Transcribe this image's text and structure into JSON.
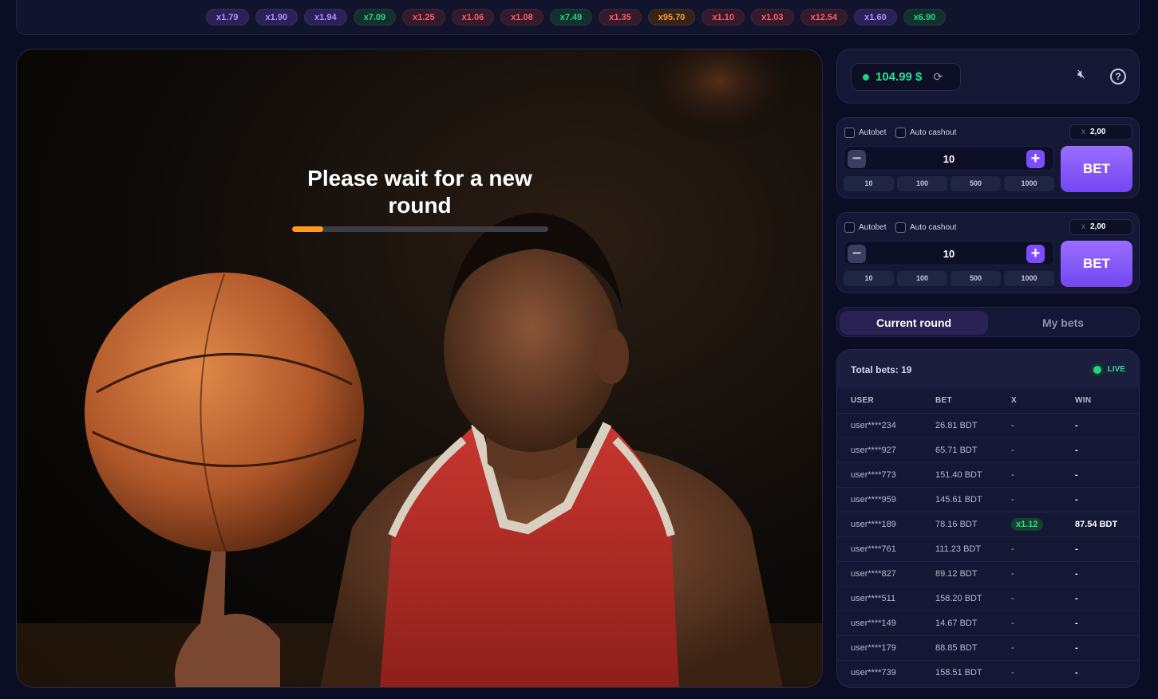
{
  "history": {
    "multipliers": [
      {
        "label": "x1.79",
        "tone": "purple"
      },
      {
        "label": "x1.90",
        "tone": "purple"
      },
      {
        "label": "x1.94",
        "tone": "purple"
      },
      {
        "label": "x7.09",
        "tone": "green"
      },
      {
        "label": "x1.25",
        "tone": "red"
      },
      {
        "label": "x1.06",
        "tone": "red"
      },
      {
        "label": "x1.08",
        "tone": "red"
      },
      {
        "label": "x7.49",
        "tone": "green"
      },
      {
        "label": "x1.35",
        "tone": "red"
      },
      {
        "label": "x95.70",
        "tone": "gold"
      },
      {
        "label": "x1.10",
        "tone": "red"
      },
      {
        "label": "x1.03",
        "tone": "red"
      },
      {
        "label": "x12.54",
        "tone": "red"
      },
      {
        "label": "x1.60",
        "tone": "purple"
      },
      {
        "label": "x6.90",
        "tone": "green"
      }
    ]
  },
  "game": {
    "status_text": "Please wait for a new round",
    "round_progress": 0.12
  },
  "header": {
    "balance": "104.99 $",
    "refresh_icon": "refresh-icon",
    "mute_icon": "speaker-muted-icon",
    "help_icon": "question-icon"
  },
  "bet_panels": [
    {
      "autobet_label": "Autobet",
      "autocashout_label": "Auto cashout",
      "coef_prefix": "x",
      "coef_value": "2,00",
      "amount": "10",
      "quick_amounts": [
        "10",
        "100",
        "500",
        "1000"
      ],
      "bet_label": "BET"
    },
    {
      "autobet_label": "Autobet",
      "autocashout_label": "Auto cashout",
      "coef_prefix": "x",
      "coef_value": "2,00",
      "amount": "10",
      "quick_amounts": [
        "10",
        "100",
        "500",
        "1000"
      ],
      "bet_label": "BET"
    }
  ],
  "tabs": {
    "current": "Current round",
    "mine": "My bets"
  },
  "bets_table": {
    "total_label": "Total bets: 19",
    "live_label": "LIVE",
    "columns": [
      "USER",
      "BET",
      "X",
      "WIN"
    ],
    "rows": [
      {
        "user": "user****234",
        "bet": "26.81 BDT",
        "x": "-",
        "win": "-"
      },
      {
        "user": "user****927",
        "bet": "65.71 BDT",
        "x": "-",
        "win": "-"
      },
      {
        "user": "user****773",
        "bet": "151.40 BDT",
        "x": "-",
        "win": "-"
      },
      {
        "user": "user****959",
        "bet": "145.61 BDT",
        "x": "-",
        "win": "-"
      },
      {
        "user": "user****189",
        "bet": "78.16 BDT",
        "x": "x1.12",
        "win": "87.54 BDT"
      },
      {
        "user": "user****761",
        "bet": "111.23 BDT",
        "x": "-",
        "win": "-"
      },
      {
        "user": "user****827",
        "bet": "89.12 BDT",
        "x": "-",
        "win": "-"
      },
      {
        "user": "user****511",
        "bet": "158.20 BDT",
        "x": "-",
        "win": "-"
      },
      {
        "user": "user****149",
        "bet": "14.67 BDT",
        "x": "-",
        "win": "-"
      },
      {
        "user": "user****179",
        "bet": "88.85 BDT",
        "x": "-",
        "win": "-"
      },
      {
        "user": "user****739",
        "bet": "158.51 BDT",
        "x": "-",
        "win": "-"
      }
    ]
  }
}
